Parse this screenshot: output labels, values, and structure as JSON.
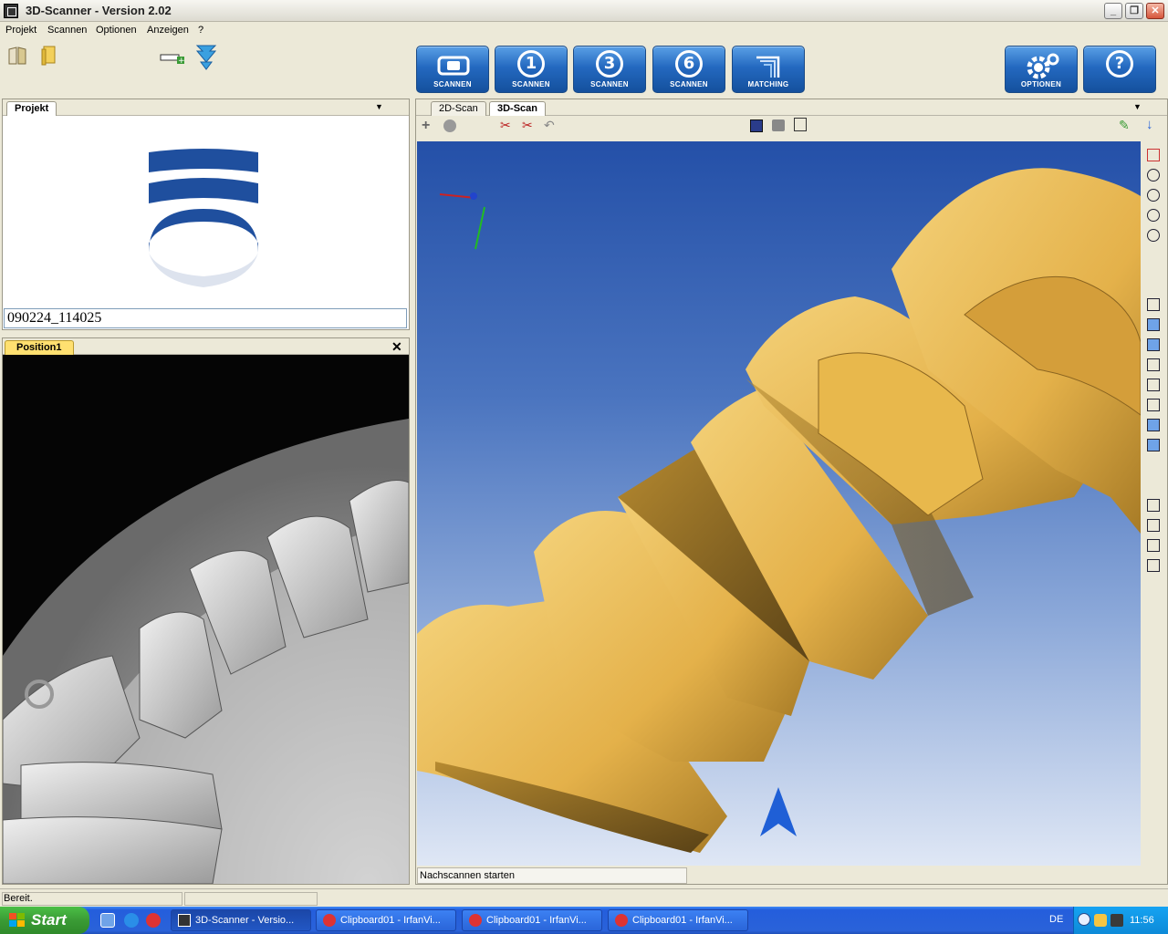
{
  "window": {
    "title": "3D-Scanner  -  Version 2.02"
  },
  "menu": [
    "Projekt",
    "Scannen",
    "Optionen",
    "Anzeigen",
    "?"
  ],
  "scan_buttons": [
    {
      "icon": "scanner-icon",
      "label": "SCANNEN"
    },
    {
      "icon": "number-1-icon",
      "glyph": "1",
      "label": "SCANNEN"
    },
    {
      "icon": "number-3-icon",
      "glyph": "3",
      "label": "SCANNEN"
    },
    {
      "icon": "number-6-icon",
      "glyph": "6",
      "label": "SCANNEN"
    },
    {
      "icon": "matching-icon",
      "label": "MATCHING"
    }
  ],
  "options_button": {
    "label": "OPTIONEN"
  },
  "help_button": {
    "glyph": "?"
  },
  "project_panel": {
    "tab": "Projekt",
    "id_value": "090224_114025"
  },
  "position_panel": {
    "tab": "Position1"
  },
  "scan_panel": {
    "tabs": [
      {
        "label": "2D-Scan",
        "active": false
      },
      {
        "label": "3D-Scan",
        "active": true
      }
    ],
    "status": "Nachscannen starten"
  },
  "statusbar": {
    "text": "Bereit."
  },
  "taskbar": {
    "start": "Start",
    "tasks": [
      {
        "label": "3D-Scanner  - Versio...",
        "active": true
      },
      {
        "label": "Clipboard01 - IrfanVi...",
        "active": false
      },
      {
        "label": "Clipboard01 - IrfanVi...",
        "active": false
      },
      {
        "label": "Clipboard01 - IrfanVi...",
        "active": false
      }
    ],
    "lang": "DE",
    "clock": "11:56"
  },
  "colors": {
    "button_blue": "#2469c0",
    "tooth_gold": "#e9b94c",
    "viewport_top": "#2450a8",
    "taskbar_blue": "#245edc"
  }
}
